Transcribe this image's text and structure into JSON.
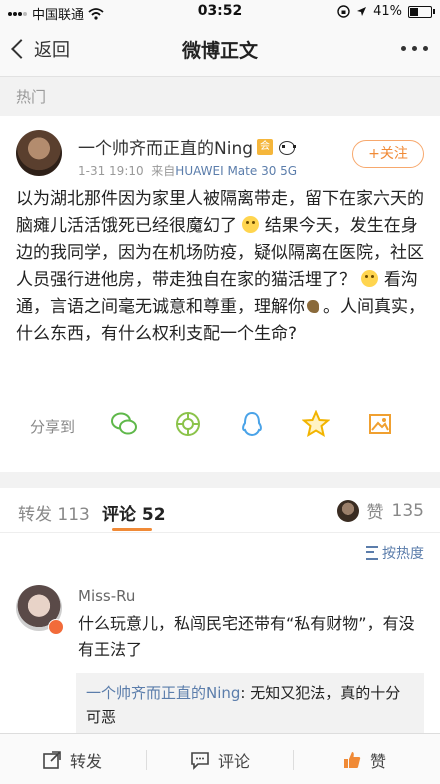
{
  "status_bar": {
    "carrier": "中国联通",
    "time": "03:52",
    "battery_percent": "41%",
    "battery_level": 0.41
  },
  "nav": {
    "back_label": "返回",
    "title": "微博正文"
  },
  "section_label": "热门",
  "post": {
    "username": "一个帅齐而正直的Ning",
    "time": "1-31 19:10",
    "source_prefix": "来自",
    "source": "HUAWEI Mate 30 5G",
    "follow_label": "+关注",
    "text_parts": [
      "以为湖北那件因为家里人被隔离带走，留下在家六天的脑瘫儿活活饿死已经很魔幻了",
      "结果今天，发生在身边的我同学，因为在机场防疫，疑似隔离在医院，社区人员强行进他房，带走独自在家的猫活埋了？",
      "看沟通，言语之间毫无诚意和尊重，理解你",
      "。人间真实，什么东西，有什么权利支配一个生命?"
    ],
    "share_label": "分享到",
    "share_icons": [
      "wechat-icon",
      "moments-icon",
      "qq-icon",
      "qzone-icon",
      "album-icon"
    ]
  },
  "tabs": {
    "repost_label": "转发",
    "repost_count": "113",
    "comment_label": "评论",
    "comment_count": "52",
    "like_label": "赞",
    "like_count": "135"
  },
  "sort_label": "按热度",
  "comment": {
    "name": "Miss-Ru",
    "text": "什么玩意儿，私闯民宅还带有“私有财物”，有没有王法了",
    "reply_name": "一个帅齐而正直的Ning",
    "reply_text": ": 无知又犯法，真的十分可恶"
  },
  "bottom_bar": {
    "repost": "转发",
    "comment": "评论",
    "like": "赞"
  },
  "colors": {
    "accent": "#f08a36",
    "link": "#5b7dab"
  }
}
